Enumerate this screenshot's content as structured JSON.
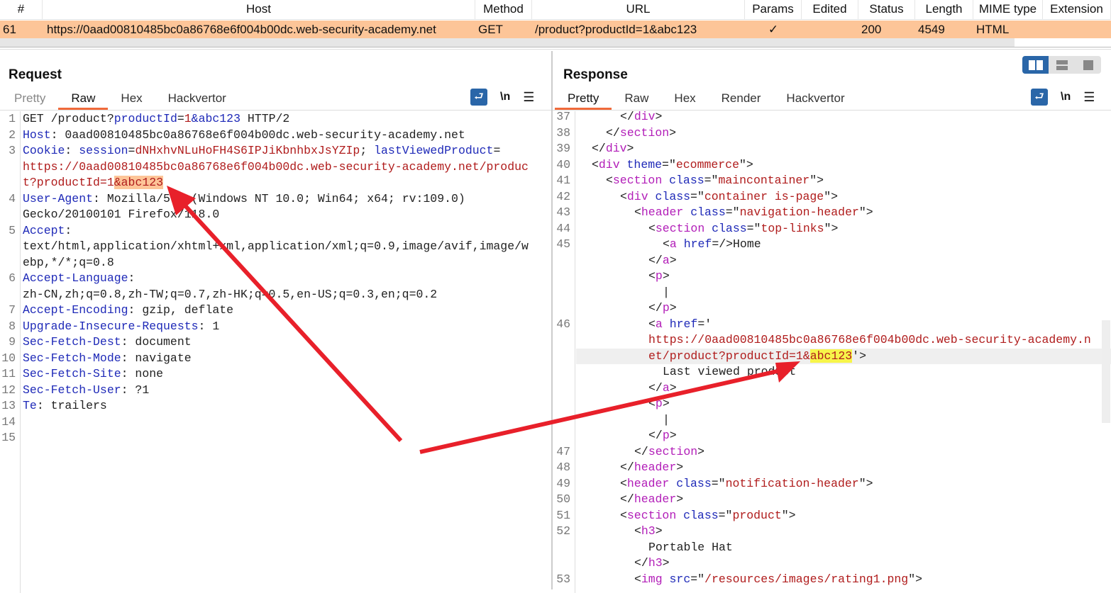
{
  "table": {
    "columns": [
      "#",
      "Host",
      "Method",
      "URL",
      "Params",
      "Edited",
      "Status",
      "Length",
      "MIME type",
      "Extension"
    ],
    "rows": [
      [
        "61",
        "https://0aad00810485bc0a86768e6f004b00dc.web-security-academy.net",
        "GET",
        "/product?productId=1&abc123",
        "✓",
        "",
        "200",
        "4549",
        "HTML",
        ""
      ]
    ],
    "selected_color": "#fdc598"
  },
  "request": {
    "title": "Request",
    "tabs": [
      "Pretty",
      "Raw",
      "Hex",
      "Hackvertor"
    ],
    "active_tab": "Raw",
    "lines": [
      {
        "n": "1",
        "i": 0,
        "tk": [
          [
            "p",
            "GET /product?"
          ],
          [
            "k",
            "productId"
          ],
          [
            "p",
            "="
          ],
          [
            "v",
            "1"
          ],
          [
            "k",
            "&abc123"
          ],
          [
            "p",
            " HTTP/2"
          ]
        ]
      },
      {
        "n": "2",
        "i": 0,
        "tk": [
          [
            "k",
            "Host"
          ],
          [
            "p",
            ": 0aad00810485bc0a86768e6f004b00dc.web-security-academy.net"
          ]
        ]
      },
      {
        "n": "3",
        "i": 0,
        "tk": [
          [
            "k",
            "Cookie"
          ],
          [
            "p",
            ": "
          ],
          [
            "k",
            "session"
          ],
          [
            "p",
            "="
          ],
          [
            "v",
            "dNHxhvNLuHoFH4S6IPJiKbnhbxJsYZIp"
          ],
          [
            "p",
            "; "
          ],
          [
            "k",
            "lastViewedProduct"
          ],
          [
            "p",
            "="
          ]
        ]
      },
      {
        "n": "",
        "i": 0,
        "tk": [
          [
            "v",
            "https://0aad00810485bc0a86768e6f004b00dc.web-security-academy.net/produc"
          ]
        ]
      },
      {
        "n": "",
        "i": 0,
        "tk": [
          [
            "v",
            "t?productId=1"
          ],
          [
            "v hl",
            "&abc123"
          ]
        ]
      },
      {
        "n": "4",
        "i": 0,
        "tk": [
          [
            "k",
            "User-Agent"
          ],
          [
            "p",
            ": Mozilla/5.0 (Windows NT 10.0; Win64; x64; rv:109.0)"
          ]
        ]
      },
      {
        "n": "",
        "i": 0,
        "tk": [
          [
            "p",
            "Gecko/20100101 Firefox/118.0"
          ]
        ]
      },
      {
        "n": "5",
        "i": 0,
        "tk": [
          [
            "k",
            "Accept"
          ],
          [
            "p",
            ":"
          ]
        ]
      },
      {
        "n": "",
        "i": 0,
        "tk": [
          [
            "p",
            "text/html,application/xhtml+xml,application/xml;q=0.9,image/avif,image/w"
          ]
        ]
      },
      {
        "n": "",
        "i": 0,
        "tk": [
          [
            "p",
            "ebp,*/*;q=0.8"
          ]
        ]
      },
      {
        "n": "6",
        "i": 0,
        "tk": [
          [
            "k",
            "Accept-Language"
          ],
          [
            "p",
            ":"
          ]
        ]
      },
      {
        "n": "",
        "i": 0,
        "tk": [
          [
            "p",
            "zh-CN,zh;q=0.8,zh-TW;q=0.7,zh-HK;q=0.5,en-US;q=0.3,en;q=0.2"
          ]
        ]
      },
      {
        "n": "7",
        "i": 0,
        "tk": [
          [
            "k",
            "Accept-Encoding"
          ],
          [
            "p",
            ": gzip, deflate"
          ]
        ]
      },
      {
        "n": "8",
        "i": 0,
        "tk": [
          [
            "k",
            "Upgrade-Insecure-Requests"
          ],
          [
            "p",
            ": 1"
          ]
        ]
      },
      {
        "n": "9",
        "i": 0,
        "tk": [
          [
            "k",
            "Sec-Fetch-Dest"
          ],
          [
            "p",
            ": document"
          ]
        ]
      },
      {
        "n": "10",
        "i": 0,
        "tk": [
          [
            "k",
            "Sec-Fetch-Mode"
          ],
          [
            "p",
            ": navigate"
          ]
        ]
      },
      {
        "n": "11",
        "i": 0,
        "tk": [
          [
            "k",
            "Sec-Fetch-Site"
          ],
          [
            "p",
            ": none"
          ]
        ]
      },
      {
        "n": "12",
        "i": 0,
        "tk": [
          [
            "k",
            "Sec-Fetch-User"
          ],
          [
            "p",
            ": ?1"
          ]
        ]
      },
      {
        "n": "13",
        "i": 0,
        "tk": [
          [
            "k",
            "Te"
          ],
          [
            "p",
            ": trailers"
          ]
        ]
      },
      {
        "n": "14",
        "i": 0,
        "tk": []
      },
      {
        "n": "15",
        "i": 0,
        "tk": []
      }
    ]
  },
  "response": {
    "title": "Response",
    "tabs": [
      "Pretty",
      "Raw",
      "Hex",
      "Render",
      "Hackvertor"
    ],
    "active_tab": "Pretty",
    "lines": [
      {
        "n": "37",
        "i": 6,
        "tk": [
          [
            "p",
            "</"
          ],
          [
            "t",
            "div"
          ],
          [
            "p",
            ">"
          ]
        ]
      },
      {
        "n": "38",
        "i": 4,
        "tk": [
          [
            "p",
            "</"
          ],
          [
            "t",
            "section"
          ],
          [
            "p",
            ">"
          ]
        ]
      },
      {
        "n": "39",
        "i": 2,
        "tk": [
          [
            "p",
            "</"
          ],
          [
            "t",
            "div"
          ],
          [
            "p",
            ">"
          ]
        ]
      },
      {
        "n": "40",
        "i": 2,
        "tk": [
          [
            "p",
            "<"
          ],
          [
            "t",
            "div"
          ],
          [
            "k",
            " theme"
          ],
          [
            "p",
            "=\""
          ],
          [
            "v",
            "ecommerce"
          ],
          [
            "p",
            "\">"
          ]
        ]
      },
      {
        "n": "41",
        "i": 4,
        "tk": [
          [
            "p",
            "<"
          ],
          [
            "t",
            "section"
          ],
          [
            "k",
            " class"
          ],
          [
            "p",
            "=\""
          ],
          [
            "v",
            "maincontainer"
          ],
          [
            "p",
            "\">"
          ]
        ]
      },
      {
        "n": "42",
        "i": 6,
        "tk": [
          [
            "p",
            "<"
          ],
          [
            "t",
            "div"
          ],
          [
            "k",
            " class"
          ],
          [
            "p",
            "=\""
          ],
          [
            "v",
            "container is-page"
          ],
          [
            "p",
            "\">"
          ]
        ]
      },
      {
        "n": "43",
        "i": 8,
        "tk": [
          [
            "p",
            "<"
          ],
          [
            "t",
            "header"
          ],
          [
            "k",
            " class"
          ],
          [
            "p",
            "=\""
          ],
          [
            "v",
            "navigation-header"
          ],
          [
            "p",
            "\">"
          ]
        ]
      },
      {
        "n": "44",
        "i": 10,
        "tk": [
          [
            "p",
            "<"
          ],
          [
            "t",
            "section"
          ],
          [
            "k",
            " class"
          ],
          [
            "p",
            "=\""
          ],
          [
            "v",
            "top-links"
          ],
          [
            "p",
            "\">"
          ]
        ]
      },
      {
        "n": "45",
        "i": 12,
        "tk": [
          [
            "p",
            "<"
          ],
          [
            "t",
            "a"
          ],
          [
            "k",
            " href"
          ],
          [
            "p",
            "=/>Home"
          ]
        ]
      },
      {
        "n": "",
        "i": 10,
        "tk": [
          [
            "p",
            "</"
          ],
          [
            "t",
            "a"
          ],
          [
            "p",
            ">"
          ]
        ]
      },
      {
        "n": "",
        "i": 10,
        "tk": [
          [
            "p",
            "<"
          ],
          [
            "t",
            "p"
          ],
          [
            "p",
            ">"
          ]
        ]
      },
      {
        "n": "",
        "i": 12,
        "tk": [
          [
            "p",
            "|"
          ]
        ]
      },
      {
        "n": "",
        "i": 10,
        "tk": [
          [
            "p",
            "</"
          ],
          [
            "t",
            "p"
          ],
          [
            "p",
            ">"
          ]
        ]
      },
      {
        "n": "46",
        "i": 10,
        "tk": [
          [
            "p",
            "<"
          ],
          [
            "t",
            "a"
          ],
          [
            "k",
            " href"
          ],
          [
            "p",
            "='"
          ]
        ]
      },
      {
        "n": "",
        "i": 10,
        "tk": [
          [
            "v",
            "https://0aad00810485bc0a86768e6f004b00dc.web-security-academy.n"
          ]
        ]
      },
      {
        "n": "",
        "i": 10,
        "sel": true,
        "tk": [
          [
            "v",
            "et/product?productId=1&"
          ],
          [
            "v yl",
            "abc123"
          ],
          [
            "p",
            "'>"
          ]
        ]
      },
      {
        "n": "",
        "i": 12,
        "tk": [
          [
            "p",
            "Last viewed product"
          ]
        ]
      },
      {
        "n": "",
        "i": 10,
        "tk": [
          [
            "p",
            "</"
          ],
          [
            "t",
            "a"
          ],
          [
            "p",
            ">"
          ]
        ]
      },
      {
        "n": "",
        "i": 10,
        "tk": [
          [
            "p",
            "<"
          ],
          [
            "t",
            "p"
          ],
          [
            "p",
            ">"
          ]
        ]
      },
      {
        "n": "",
        "i": 12,
        "tk": [
          [
            "p",
            "|"
          ]
        ]
      },
      {
        "n": "",
        "i": 10,
        "tk": [
          [
            "p",
            "</"
          ],
          [
            "t",
            "p"
          ],
          [
            "p",
            ">"
          ]
        ]
      },
      {
        "n": "47",
        "i": 8,
        "tk": [
          [
            "p",
            "</"
          ],
          [
            "t",
            "section"
          ],
          [
            "p",
            ">"
          ]
        ]
      },
      {
        "n": "48",
        "i": 6,
        "tk": [
          [
            "p",
            "</"
          ],
          [
            "t",
            "header"
          ],
          [
            "p",
            ">"
          ]
        ]
      },
      {
        "n": "49",
        "i": 6,
        "tk": [
          [
            "p",
            "<"
          ],
          [
            "t",
            "header"
          ],
          [
            "k",
            " class"
          ],
          [
            "p",
            "=\""
          ],
          [
            "v",
            "notification-header"
          ],
          [
            "p",
            "\">"
          ]
        ]
      },
      {
        "n": "50",
        "i": 6,
        "tk": [
          [
            "p",
            "</"
          ],
          [
            "t",
            "header"
          ],
          [
            "p",
            ">"
          ]
        ]
      },
      {
        "n": "51",
        "i": 6,
        "tk": [
          [
            "p",
            "<"
          ],
          [
            "t",
            "section"
          ],
          [
            "k",
            " class"
          ],
          [
            "p",
            "=\""
          ],
          [
            "v",
            "product"
          ],
          [
            "p",
            "\">"
          ]
        ]
      },
      {
        "n": "52",
        "i": 8,
        "tk": [
          [
            "p",
            "<"
          ],
          [
            "t",
            "h3"
          ],
          [
            "p",
            ">"
          ]
        ]
      },
      {
        "n": "",
        "i": 10,
        "tk": [
          [
            "p",
            "Portable Hat"
          ]
        ]
      },
      {
        "n": "",
        "i": 8,
        "tk": [
          [
            "p",
            "</"
          ],
          [
            "t",
            "h3"
          ],
          [
            "p",
            ">"
          ]
        ]
      },
      {
        "n": "53",
        "i": 8,
        "tk": [
          [
            "p",
            "<"
          ],
          [
            "t",
            "img"
          ],
          [
            "k",
            " src"
          ],
          [
            "p",
            "=\""
          ],
          [
            "v",
            "/resources/images/rating1.png"
          ],
          [
            "p",
            "\">"
          ]
        ]
      }
    ]
  },
  "icons": {
    "wrap": "word-wrap-icon",
    "newline": "\\n",
    "menu": "☰"
  },
  "annotation_color": "#e8202a"
}
